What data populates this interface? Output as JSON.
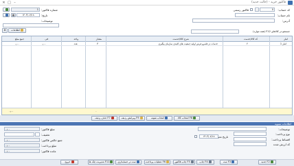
{
  "window": {
    "title": "فاکتور خرید - (حالت جدید)",
    "minimize": "–",
    "maximize": "□",
    "close": "✕"
  },
  "header": {
    "account_code_label": "کد حساب:",
    "account_code_value": "0",
    "account_name_label": "نام حساب:",
    "address_label": "آدرس:",
    "official_invoice_label": "فاکتور رسمی",
    "invoice_no_label": "شماره فاکتور:",
    "invoice_no_value": "1",
    "date_label": "تاریخ:",
    "date_value": "۱۴۰۳/۰۷/۱۸",
    "description_label": "توضیحات:",
    "search_label": "جستجو در کالاهای F12 (همه موارد)",
    "info_button": "اطلاعات"
  },
  "table": {
    "columns": [
      "انبار",
      "کد کالا/خدمت",
      "شرح کالا/خدمت",
      "مقدار",
      "واحد",
      "فی",
      "جمع مبلغ"
    ],
    "rows": [
      {
        "warehouse": "انبار 1",
        "code": "۲",
        "desc": "خدمات در قلمرو فرش اولیه جمعیت های کلیدی سازمان پیگیری",
        "qty": "۳",
        "unit": "عدد",
        "price": "۰٫۰۰",
        "total": "۰٫۰۰"
      }
    ],
    "footer_qty": "۰",
    "footer_total": "۰٫۰۰"
  },
  "actions": {
    "select_item": "انتخاب کالا",
    "select_template": "انتخاب نمونه",
    "edit_row": "ویرایش ردیف",
    "delete_row": "حذف ردیف",
    "select_item_key": "F8",
    "edit_row_key": "F9",
    "delete_row_key": "F7"
  },
  "settlement": {
    "section_title": "اطلاعات تسویه",
    "description_label": "توضیحات:",
    "payment_type_label": "نوع پرداخت:",
    "payment_date_label": "تاریخ تحویل:",
    "payment_date_value": "۱۴۰۳/۰۷/۱۸",
    "receiver_label": "اقساط پرداخت:",
    "bank_label": "کد ارزش شده"
  },
  "totals": {
    "invoice_sum_label": "مبلغ فاکتور:",
    "invoice_sum_value": "۰٫۰۰",
    "discount_label": "تخفیف:",
    "discount_value": "۰",
    "net_sum_label": "جمع خالص فاکتور:",
    "paid_label": "مبلغ پرداخت:",
    "remaining_label": "مانده فاکتور:",
    "net_sum_value": "۰٫۰۰",
    "paid_value": "۰٫۰۰",
    "remaining_value": "۰٫۰۰"
  },
  "toolbar": {
    "new": "جدید",
    "save": "ثبت",
    "print": "چاپ",
    "print_invoice": "چاپ فاکتور",
    "payment_ops": "عملیات پرداخت",
    "accounting": "ثبت در حسابداری",
    "check": "مدیریت چک ها",
    "close": "خروج",
    "new_key": "F2",
    "save_key": "F3",
    "print_key": "F4",
    "print_invoice_key": "F5",
    "payment_ops_key": "F6",
    "check_key": "F11"
  },
  "colors": {
    "accent": "#4b74b3",
    "footer": "#fff8cf",
    "grid_header": "#e9eef5"
  }
}
